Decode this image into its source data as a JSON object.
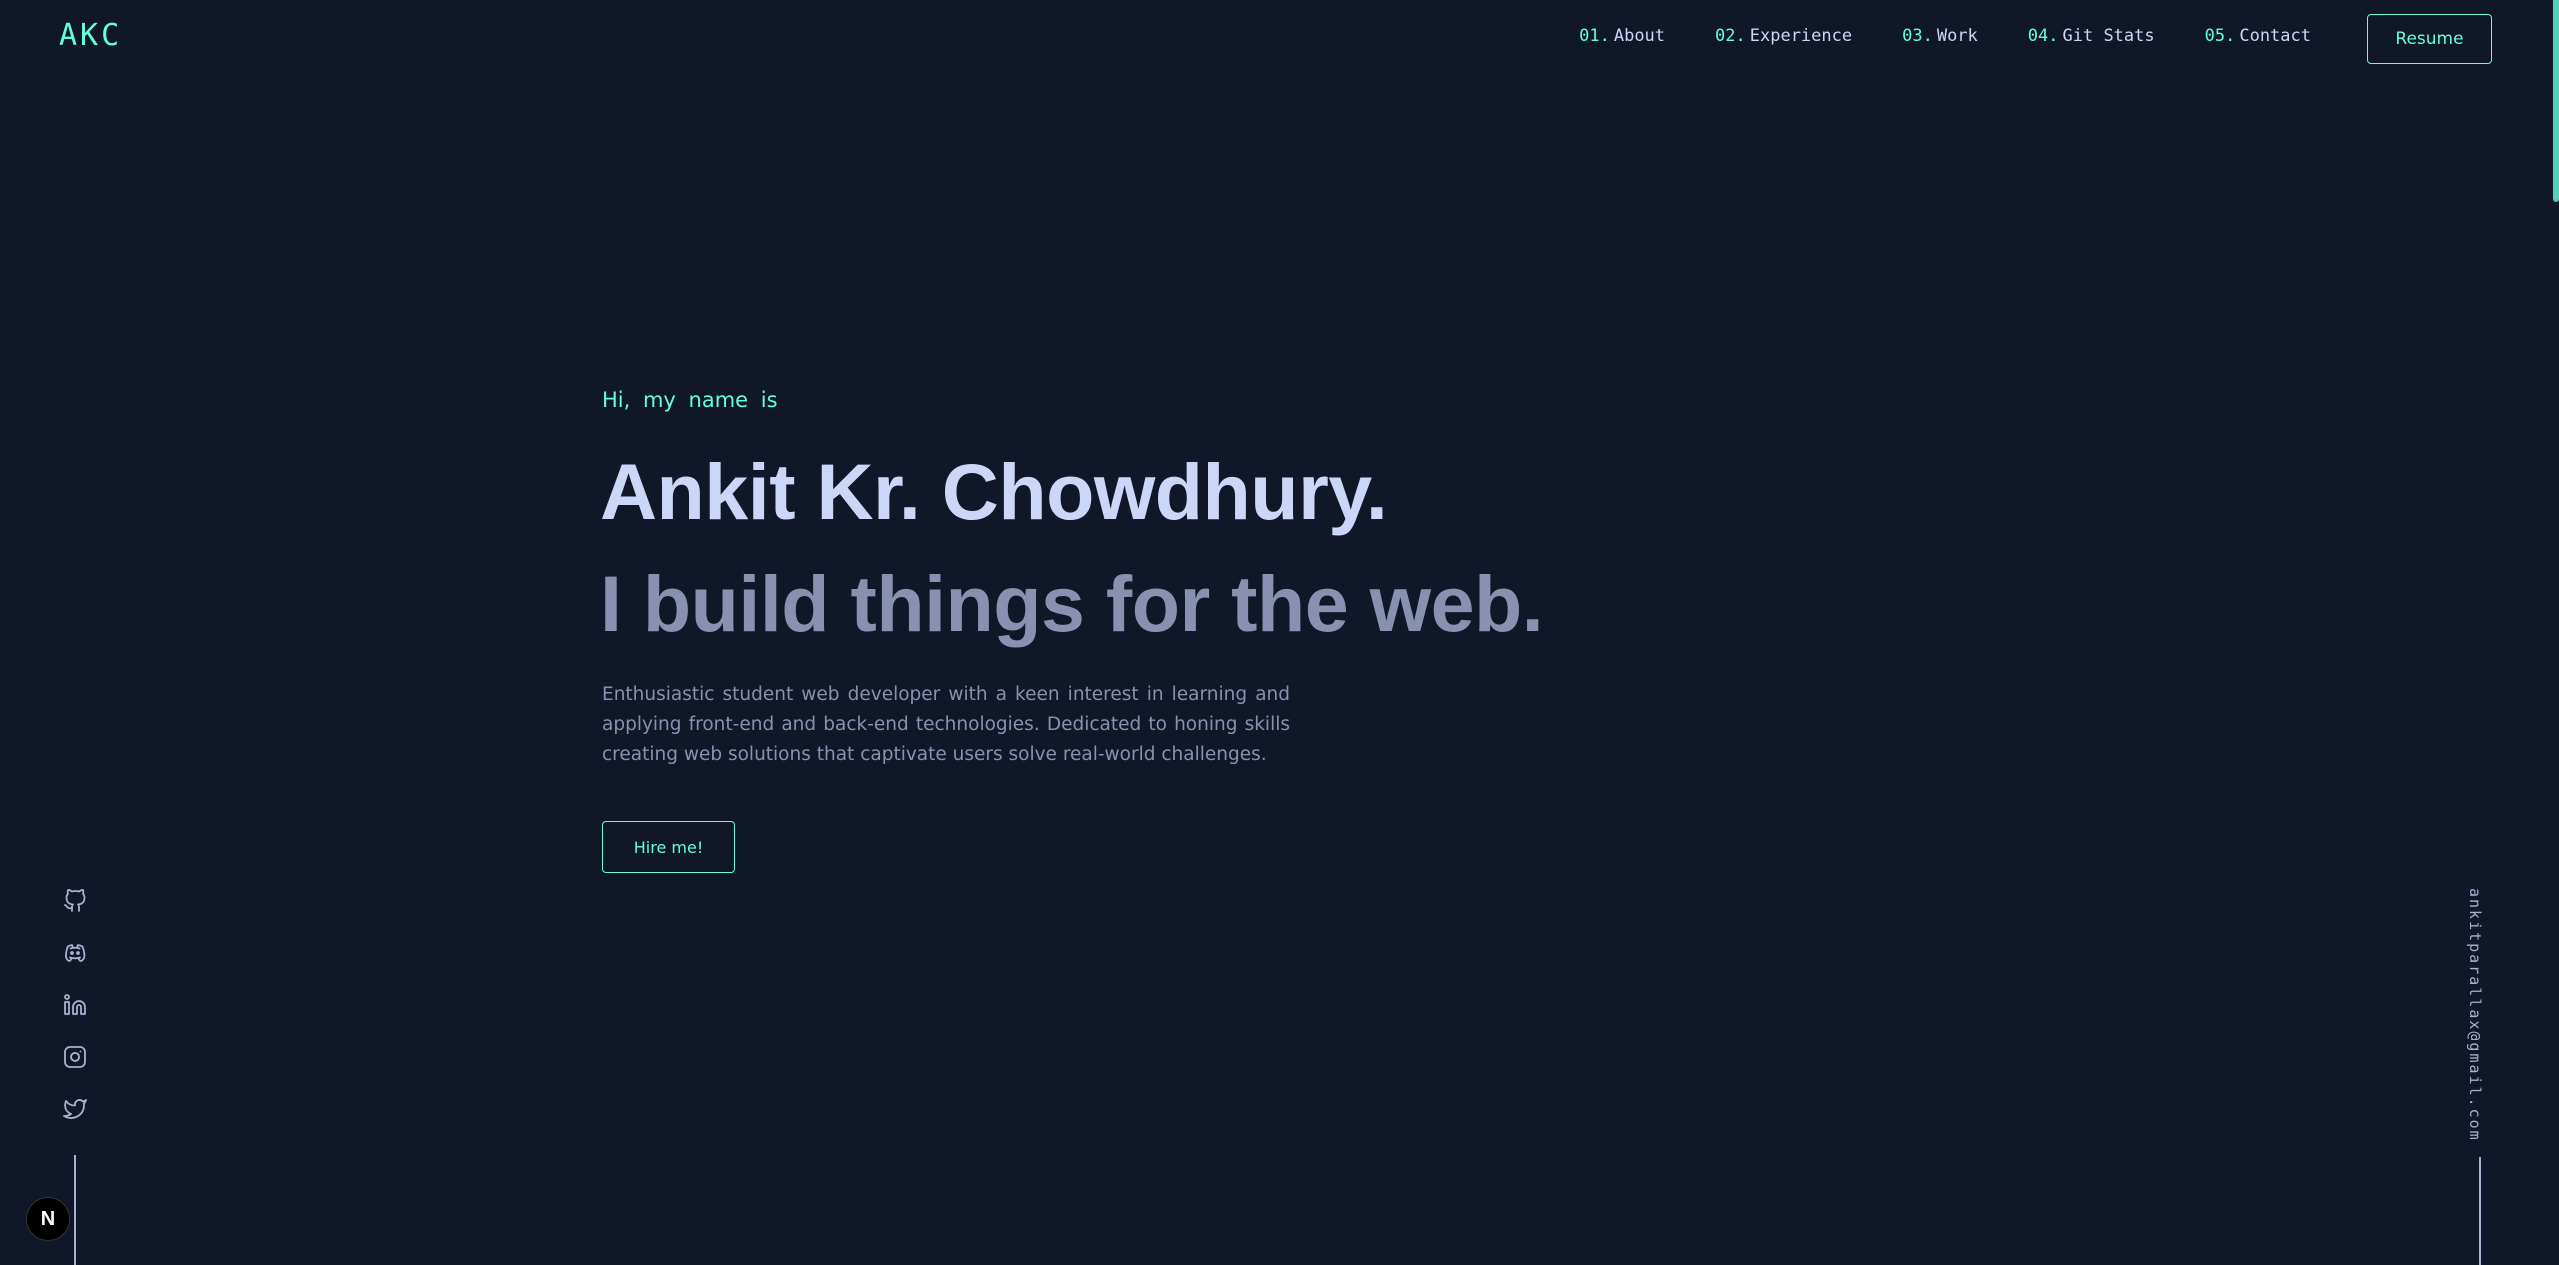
{
  "header": {
    "logo": "AKC",
    "nav": [
      {
        "num": "01.",
        "label": "About"
      },
      {
        "num": "02.",
        "label": "Experience"
      },
      {
        "num": "03.",
        "label": "Work"
      },
      {
        "num": "04.",
        "label": "Git Stats"
      },
      {
        "num": "05.",
        "label": "Contact"
      }
    ],
    "resume_label": "Resume"
  },
  "hero": {
    "greeting": "Hi, my name is",
    "name": "Ankit Kr. Chowdhury.",
    "tagline": "I build things for the web.",
    "bio": "Enthusiastic student web developer with a keen interest in learning and applying front-end and back-end technologies. Dedicated to honing skills creating web solutions that captivate users solve real-world challenges.",
    "cta_label": "Hire me!"
  },
  "social": {
    "icons": [
      "github-icon",
      "discord-icon",
      "linkedin-icon",
      "instagram-icon",
      "twitter-icon"
    ]
  },
  "email": "ankitparallax@gmail.com",
  "badge": "N",
  "colors": {
    "background": "#0f1729",
    "accent": "#64ffda",
    "heading": "#ccd6f6",
    "muted": "#8892b0"
  }
}
